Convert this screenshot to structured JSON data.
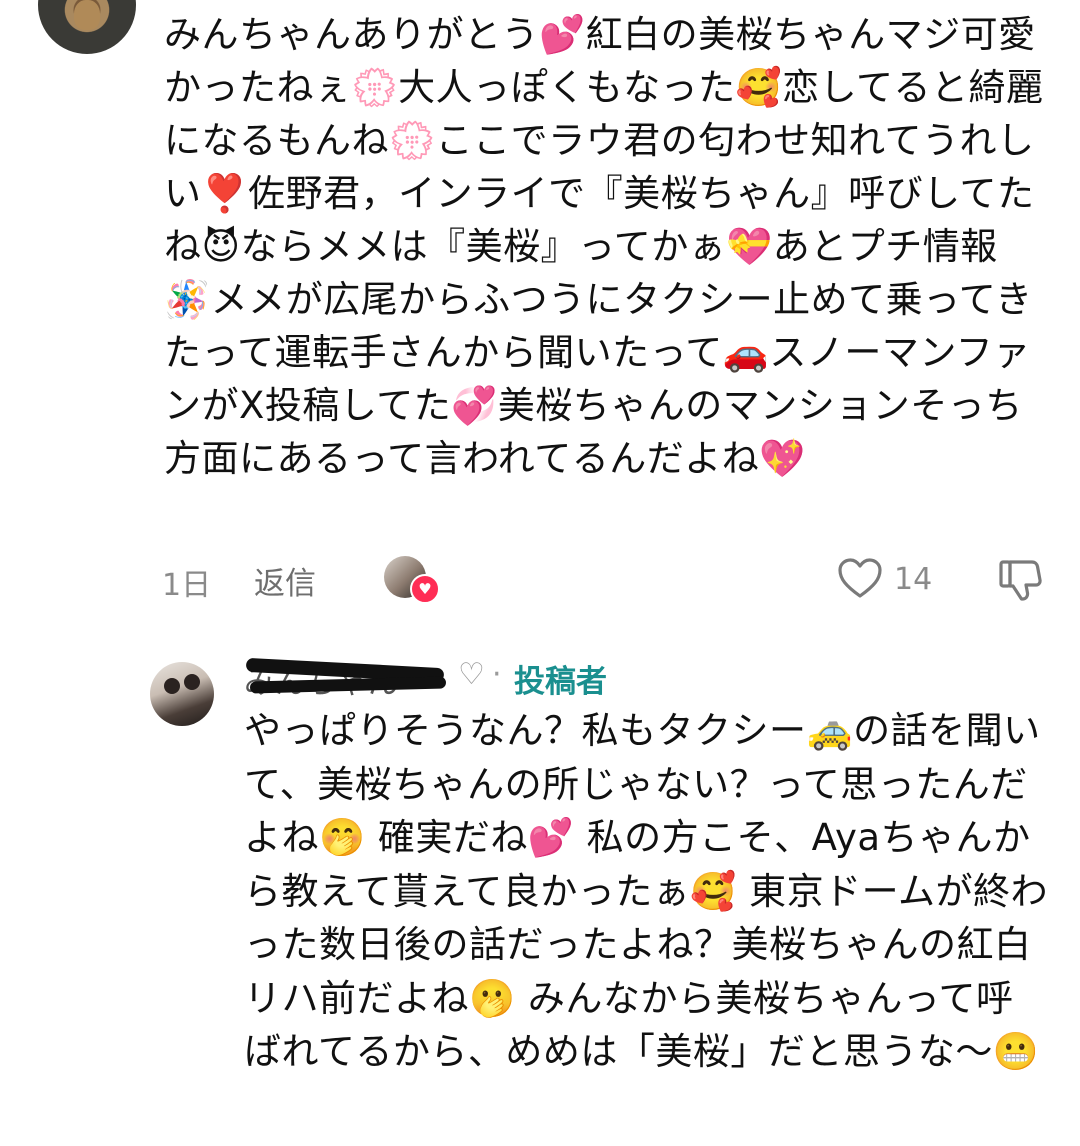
{
  "comment": {
    "text": "みんちゃんありがとう💕紅白の美桜ちゃんマジ可愛かったねぇ💮大人っぽくもなった🥰恋してると綺麗になるもんね💮ここでラウ君の匂わせ知れてうれしい❣️佐野君，インライで『美桜ちゃん』呼びしてたね😈ならメメは『美桜』ってかぁ💝あとプチ情報🪅メメが広尾からふつうにタクシー止めて乗ってきたって運転手さんから聞いたって🚗スノーマンファンがX投稿してた💞美桜ちゃんのマンションそっち方面にあるって言われてるんだよね💖",
    "time": "1日",
    "reply_label": "返信",
    "like_count": "14",
    "liked_by_author_icon": "heart-icon"
  },
  "reply": {
    "author_name": "みんちゃん",
    "author_suffix": "♡",
    "separator": "·",
    "badge": "投稿者",
    "text": "やっぱりそうなん？私もタクシー🚕の話を聞いて、美桜ちゃんの所じゃない？って思ったんだよね🤭 確実だね💕 私の方こそ、Ayaちゃんから教えて貰えて良かったぁ🥰 東京ドームが終わった数日後の話だったよね？美桜ちゃんの紅白リハ前だよね🫢 みんなから美桜ちゃんって呼ばれてるから、めめは「美桜」だと思うな〜😬"
  },
  "colors": {
    "badge": "#1a8f8f",
    "meta_text": "#8a8a8a",
    "like_heart": "#ff2d55"
  }
}
